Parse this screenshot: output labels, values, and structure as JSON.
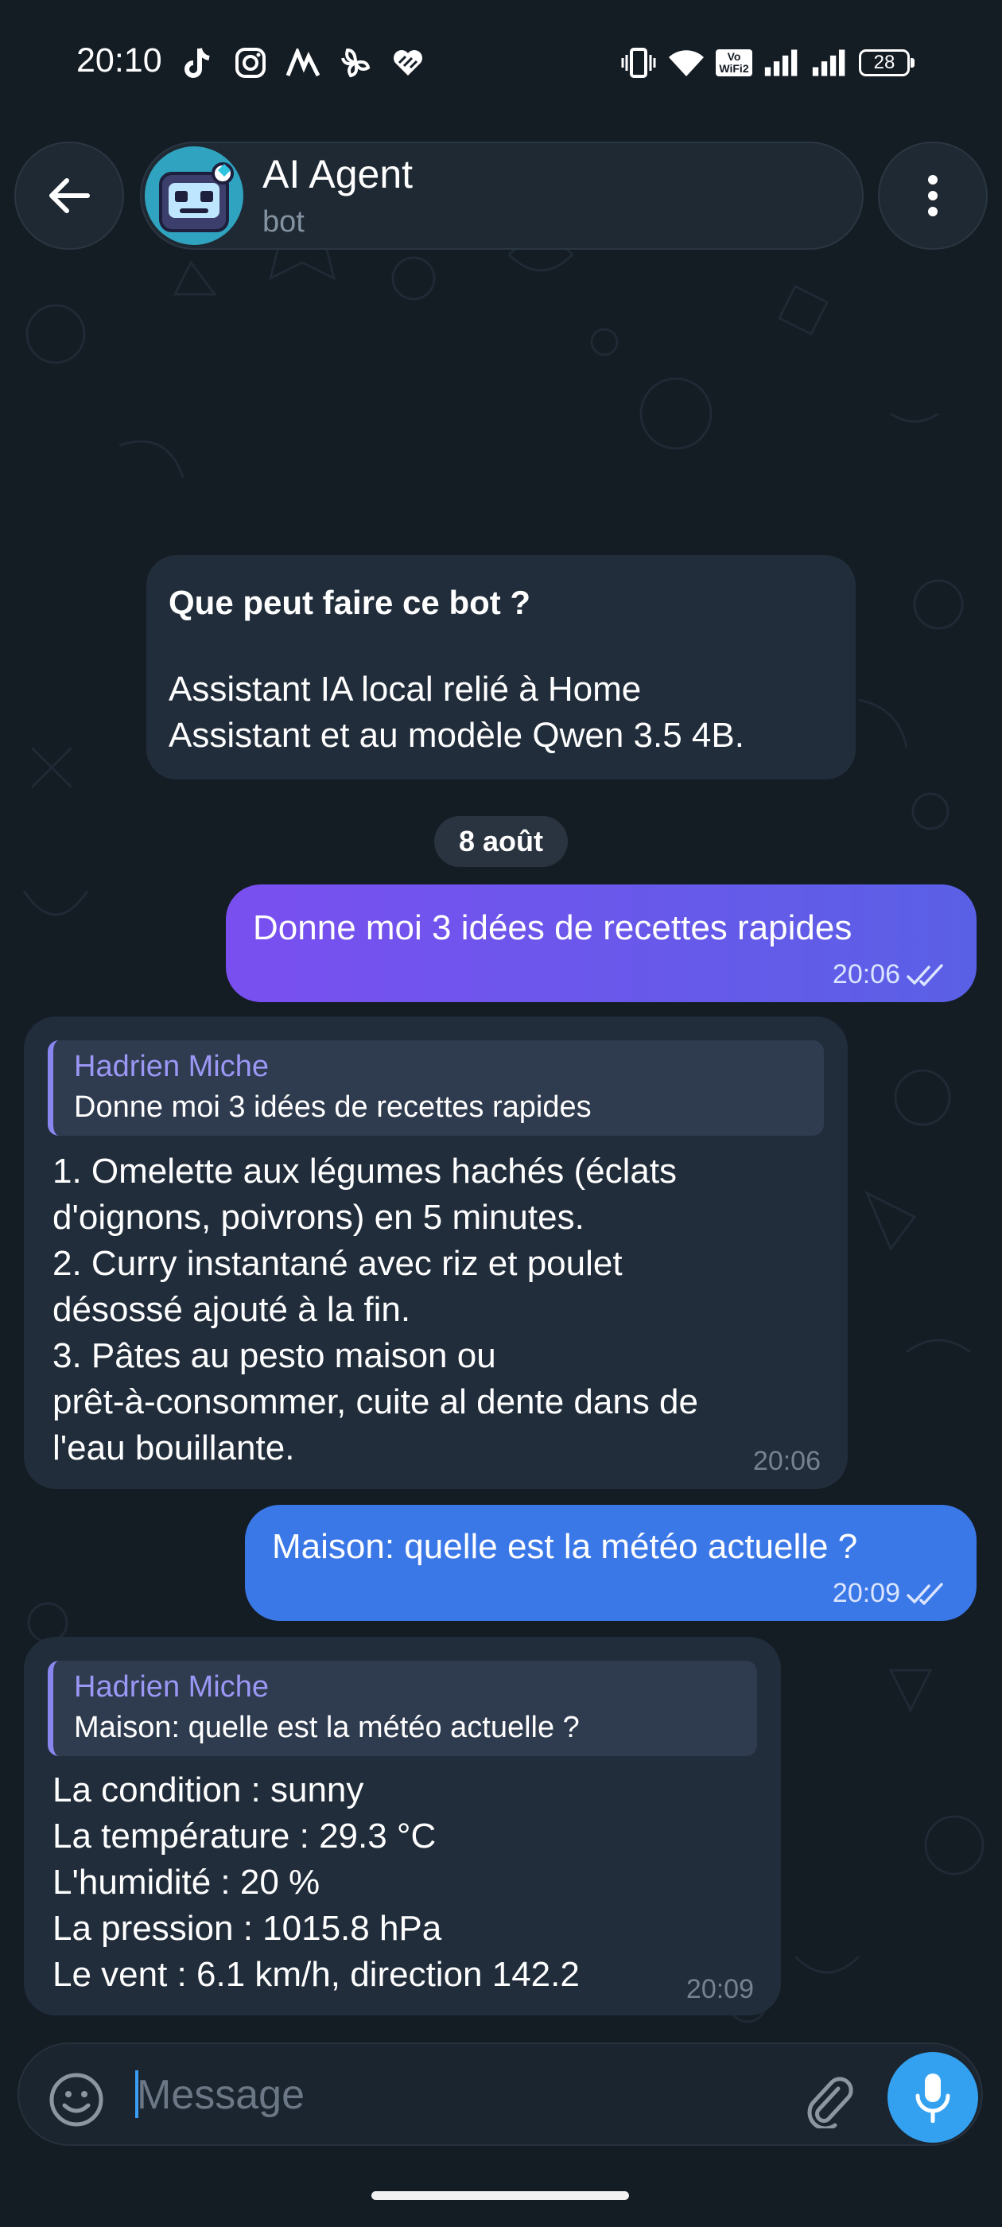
{
  "status_bar": {
    "time": "20:10",
    "left_icons": [
      "tiktok-icon",
      "instagram-icon",
      "app-icon",
      "pinwheel-icon",
      "heart-app-icon"
    ],
    "right_icons": [
      "vibrate-icon",
      "wifi-icon",
      "volte-wifi-icon",
      "signal-icon",
      "signal-icon"
    ],
    "volte_label": "Vo\nWiFi2",
    "battery": "28"
  },
  "header": {
    "title": "AI Agent",
    "subtitle": "bot",
    "back_icon": "arrow-left-icon",
    "menu_icon": "more-vertical-icon",
    "avatar_icon": "robot-avatar"
  },
  "intro_card": {
    "heading": "Que peut faire ce bot ?",
    "body": "Assistant IA local relié à Home\nAssistant et au modèle Qwen 3.5 4B."
  },
  "date_separator": "8 août",
  "messages": [
    {
      "direction": "outgoing",
      "text": "Donne moi 3 idées de recettes rapides",
      "time": "20:06",
      "read": true,
      "color": "#6a58ec"
    },
    {
      "direction": "incoming",
      "reply_to": {
        "name": "Hadrien Miche",
        "text": "Donne moi 3 idées de recettes rapides"
      },
      "text": "1. Omelette aux légumes hachés (éclats\nd'oignons, poivrons) en 5 minutes.\n2. Curry instantané avec riz et poulet\ndésossé ajouté à la fin.\n3. Pâtes au pesto maison ou\nprêt-à-consommer, cuite al dente dans de\nl'eau bouillante.",
      "time": "20:06"
    },
    {
      "direction": "outgoing",
      "text": "Maison: quelle est la météo actuelle ?",
      "time": "20:09",
      "read": true,
      "color": "#3b78e7"
    },
    {
      "direction": "incoming",
      "reply_to": {
        "name": "Hadrien Miche",
        "text": "Maison: quelle est la météo actuelle ?"
      },
      "text": "La condition : sunny\nLa température : 29.3 °C\nL'humidité : 20 %\nLa pression : 1015.8 hPa\nLe vent : 6.1 km/h, direction 142.2",
      "time": "20:09"
    }
  ],
  "composer": {
    "placeholder": "Message",
    "emoji_icon": "smiley-icon",
    "attach_icon": "paperclip-icon",
    "mic_icon": "microphone-icon"
  },
  "colors": {
    "background": "#141c24",
    "incoming_bubble": "#212d3b",
    "accent": "#33a1f0",
    "reply_accent": "#9b97f5"
  }
}
